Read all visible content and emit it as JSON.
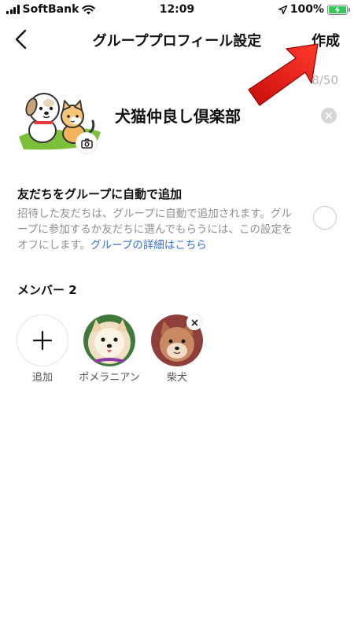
{
  "status_bar": {
    "carrier": "SoftBank",
    "time": "12:09",
    "battery": "100%"
  },
  "header": {
    "title": "グループプロフィール設定",
    "create_label": "作成"
  },
  "profile": {
    "char_count": "8/50",
    "group_name": "犬猫仲良し倶楽部"
  },
  "auto_add": {
    "title": "友だちをグループに自動で追加",
    "description": "招待した友だちは、グループに自動で追加されます。グループに参加するか友だちに選んでもらうには、この設定をオフにします。",
    "link": "グループの詳細はこちら"
  },
  "members": {
    "title": "メンバー 2",
    "add_label": "追加",
    "items": [
      {
        "name": "ポメラニアン"
      },
      {
        "name": "柴犬"
      }
    ]
  },
  "colors": {
    "link": "#3b6fd8",
    "arrow": "#e81818",
    "battery": "#34c759"
  }
}
